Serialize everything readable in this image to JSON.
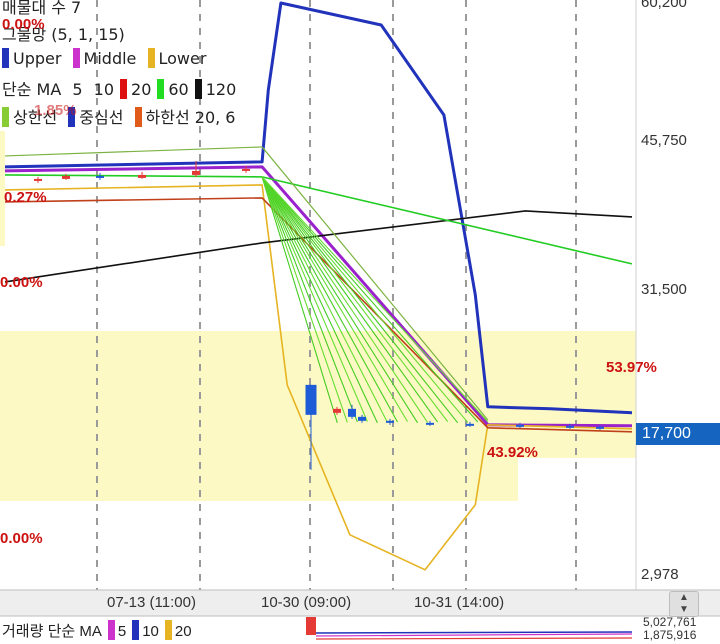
{
  "chart_data": {
    "type": "line",
    "title": "",
    "x_ticks": [
      "07-13 (11:00)",
      "10-30 (09:00)",
      "10-31 (14:00)"
    ],
    "y_ticks": [
      "60,200",
      "45,750",
      "31,500",
      "2,978"
    ],
    "ylim": [
      2978,
      60200
    ],
    "current_price": "17,700",
    "candles": [
      {
        "open": 42400,
        "close": 42600,
        "high": 42800,
        "low": 42200
      },
      {
        "open": 42600,
        "close": 42900,
        "high": 43100,
        "low": 42500
      },
      {
        "open": 42900,
        "close": 42700,
        "high": 43200,
        "low": 42500
      },
      {
        "open": 42700,
        "close": 43000,
        "high": 43300,
        "low": 42600
      },
      {
        "open": 43000,
        "close": 43400,
        "high": 44400,
        "low": 42800
      },
      {
        "open": 43400,
        "close": 43600,
        "high": 43900,
        "low": 43200
      },
      {
        "open": 22000,
        "close": 19000,
        "high": 22000,
        "low": 13500
      },
      {
        "open": 19200,
        "close": 19600,
        "high": 19800,
        "low": 19000
      },
      {
        "open": 19600,
        "close": 18800,
        "high": 20000,
        "low": 18600
      },
      {
        "open": 18800,
        "close": 18400,
        "high": 19000,
        "low": 18200
      },
      {
        "open": 18400,
        "close": 18200,
        "high": 18600,
        "low": 18000
      },
      {
        "open": 18200,
        "close": 18100,
        "high": 18400,
        "low": 17900
      },
      {
        "open": 18100,
        "close": 18000,
        "high": 18300,
        "low": 17800
      },
      {
        "open": 18000,
        "close": 17900,
        "high": 18200,
        "low": 17700
      },
      {
        "open": 17900,
        "close": 17800,
        "high": 18100,
        "low": 17600
      },
      {
        "open": 17800,
        "close": 17700,
        "high": 18000,
        "low": 17500
      }
    ],
    "series": [
      {
        "name": "Upper",
        "color": "#2233bb",
        "points": [
          [
            0,
            43800
          ],
          [
            0.41,
            44300
          ],
          [
            0.42,
            51500
          ],
          [
            0.44,
            60200
          ],
          [
            0.6,
            58000
          ],
          [
            0.7,
            49000
          ],
          [
            0.75,
            31000
          ],
          [
            0.77,
            19800
          ],
          [
            0.87,
            19600
          ],
          [
            1.0,
            19200
          ]
        ]
      },
      {
        "name": "Middle",
        "color": "#9922cc",
        "points": [
          [
            0,
            43400
          ],
          [
            0.41,
            43800
          ],
          [
            0.77,
            18000
          ],
          [
            1.0,
            17900
          ]
        ]
      },
      {
        "name": "Lower",
        "color": "#e6b422",
        "points": [
          [
            0,
            41500
          ],
          [
            0.41,
            42000
          ],
          [
            0.45,
            22000
          ],
          [
            0.55,
            7000
          ],
          [
            0.67,
            3500
          ],
          [
            0.75,
            10000
          ],
          [
            0.77,
            18000
          ],
          [
            1.0,
            17600
          ]
        ]
      },
      {
        "name": "MA 120",
        "color": "#111111",
        "points": [
          [
            0,
            32300
          ],
          [
            0.41,
            36200
          ],
          [
            0.83,
            39400
          ],
          [
            1.0,
            38800
          ]
        ]
      },
      {
        "name": "하한선",
        "color": "#c0401a",
        "points": [
          [
            0,
            40300
          ],
          [
            0.41,
            40700
          ],
          [
            0.77,
            17700
          ],
          [
            1.0,
            17300
          ]
        ]
      },
      {
        "name": "MA 60",
        "color": "#22cc22",
        "points": [
          [
            0,
            43000
          ],
          [
            0.41,
            42800
          ],
          [
            1.0,
            34100
          ]
        ]
      }
    ],
    "annotations": [
      {
        "text": "0.00%",
        "value": 60200
      },
      {
        "text": "1.85%",
        "value": 44600
      },
      {
        "text": "0.27%",
        "value": 40000
      },
      {
        "text": "0.00%",
        "value": 31500
      },
      {
        "text": "53.97%",
        "value": 22000
      },
      {
        "text": "43.92%",
        "value": 15700
      },
      {
        "text": "0.00%",
        "value": 8000
      }
    ]
  },
  "legend": {
    "row1": "매물대 수 7",
    "row2": "그물망 (5, 1, 15)",
    "bb": [
      {
        "label": "Upper",
        "color": "#2233bb"
      },
      {
        "label": "Middle",
        "color": "#cc33cc"
      },
      {
        "label": "Lower",
        "color": "#e6b422"
      }
    ],
    "ma_prefix": "단순 MA",
    "ma": [
      {
        "label": "5",
        "color": null
      },
      {
        "label": "10",
        "color": "#dd1111"
      },
      {
        "label": "20",
        "color": "#22dd22"
      },
      {
        "label": "60",
        "color": "#111111"
      },
      {
        "label": "120",
        "color": null
      }
    ],
    "env": [
      {
        "label": "상한선",
        "color": "#88cc33"
      },
      {
        "label": "중심선",
        "color": "#2233bb"
      },
      {
        "label": "하한선 20, 6",
        "color": "#e05a1a"
      }
    ]
  },
  "volume_legend": {
    "prefix": "거래량 단순 MA",
    "items": [
      {
        "label": "5",
        "color": "#cc33cc"
      },
      {
        "label": "10",
        "color": "#2233bb"
      },
      {
        "label": "20",
        "color": "#e6b422"
      }
    ],
    "ticks": [
      "5,027,761",
      "1,875,916"
    ]
  },
  "colors": {
    "highlight": "#fdf9c4",
    "price_tag": "#1565c0",
    "percent_text": "#cc1111"
  }
}
